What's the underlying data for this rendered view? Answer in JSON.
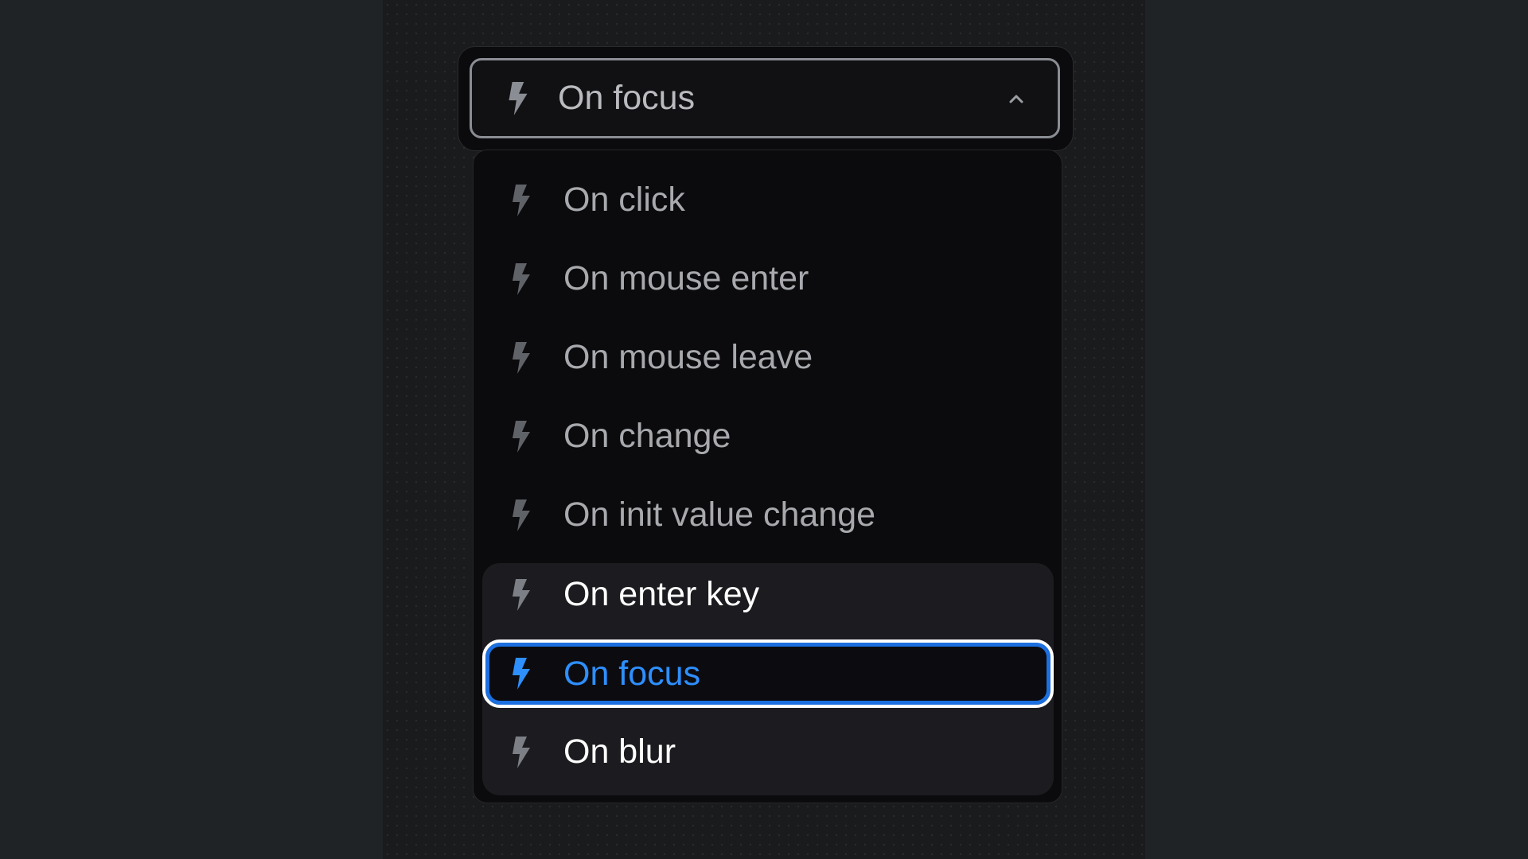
{
  "dropdown": {
    "selected_label": "On focus",
    "trigger_icon": "lightning-bolt-icon",
    "chevron_icon": "chevron-up-icon",
    "options": [
      {
        "label": "On click",
        "icon": "lightning-bolt-icon"
      },
      {
        "label": "On mouse enter",
        "icon": "lightning-bolt-icon"
      },
      {
        "label": "On mouse leave",
        "icon": "lightning-bolt-icon"
      },
      {
        "label": "On change",
        "icon": "lightning-bolt-icon"
      },
      {
        "label": "On init value change",
        "icon": "lightning-bolt-icon"
      },
      {
        "label": "On enter key",
        "icon": "lightning-bolt-icon"
      },
      {
        "label": "On focus",
        "icon": "lightning-bolt-icon"
      },
      {
        "label": "On blur",
        "icon": "lightning-bolt-icon"
      }
    ]
  },
  "colors": {
    "accent": "#2e8fff",
    "selection_ring": "#1c6fe0",
    "icon_gray": "#7c7f85"
  }
}
